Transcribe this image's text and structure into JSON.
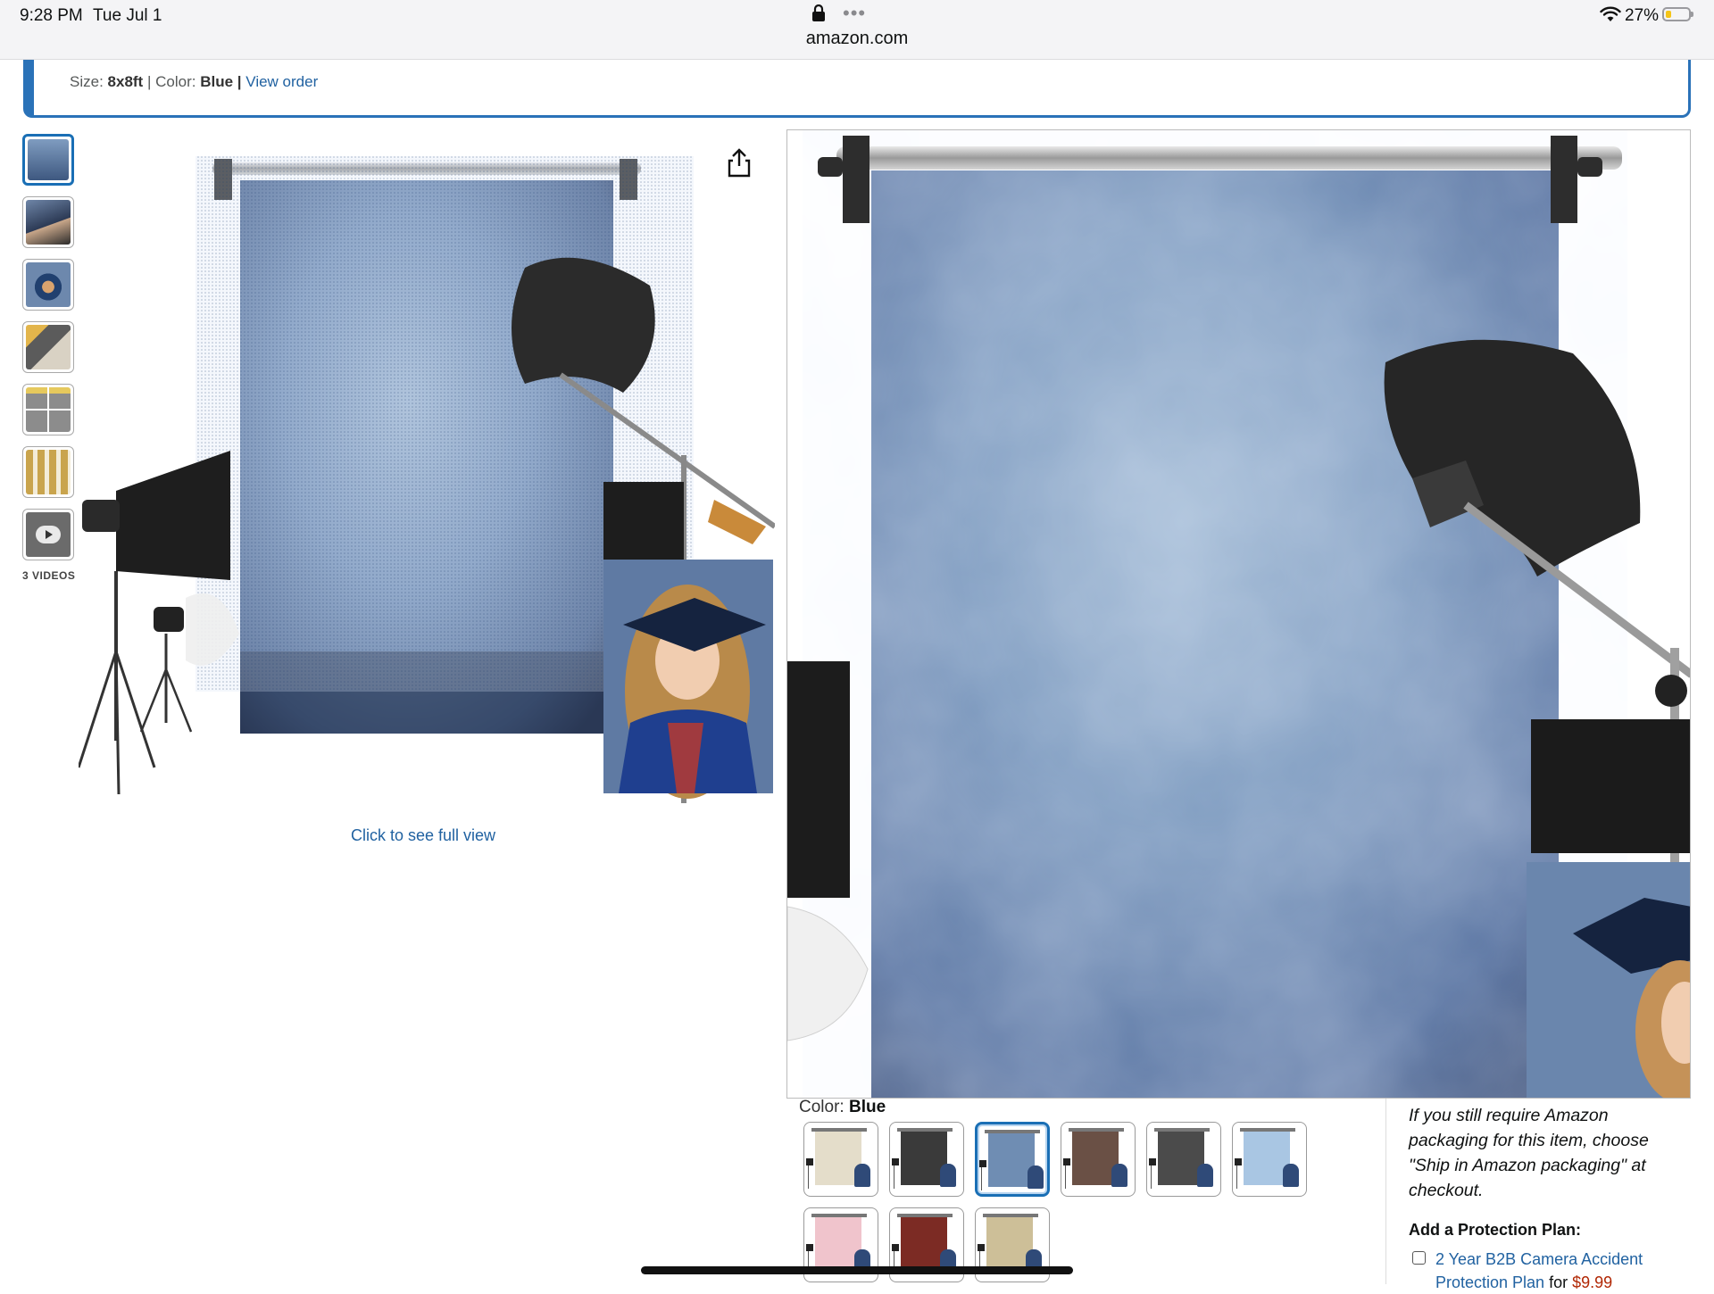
{
  "status_bar": {
    "time": "9:28 PM",
    "date": "Tue Jul 1",
    "url": "amazon.com",
    "dots": "•••",
    "battery_pct": "27%",
    "battery_level": 0.27,
    "icons": [
      "lock-icon",
      "more-dots-icon",
      "wifi-icon",
      "battery-icon"
    ]
  },
  "banner": {
    "size_label": "Size:",
    "size_value": "8x8ft",
    "color_label": "Color:",
    "color_value": "Blue",
    "separator": "|",
    "view_order": "View order"
  },
  "gallery": {
    "thumbnails": [
      {
        "name": "thumb-blue-backdrop",
        "active": true
      },
      {
        "name": "thumb-couple-portrait",
        "active": false
      },
      {
        "name": "thumb-graduate",
        "active": false
      },
      {
        "name": "thumb-fabric-detail",
        "active": false
      },
      {
        "name": "thumb-features-grid",
        "active": false
      },
      {
        "name": "thumb-size-chart",
        "active": false
      },
      {
        "name": "thumb-video",
        "active": false
      }
    ],
    "videos_label": "3 VIDEOS",
    "full_view_link": "Click to see full view",
    "share_icon": "share-icon",
    "colors": {
      "backdrop_light": "#8aa5c4",
      "backdrop_dark": "#3f5a82",
      "accent_link": "#2162a1",
      "active_border": "#1a6fb5"
    }
  },
  "variations": {
    "color_label": "Color:",
    "selected": "Blue",
    "swatches": [
      {
        "name": "swatch-cream",
        "color": "#e4ddca",
        "active": false
      },
      {
        "name": "swatch-charcoal",
        "color": "#3a3a3a",
        "active": false
      },
      {
        "name": "swatch-blue",
        "color": "#6f8db3",
        "active": true
      },
      {
        "name": "swatch-brown",
        "color": "#6a5045",
        "active": false
      },
      {
        "name": "swatch-dark-grey",
        "color": "#4b4b4b",
        "active": false
      },
      {
        "name": "swatch-light-blue",
        "color": "#a9c6e3",
        "active": false
      },
      {
        "name": "swatch-pink",
        "color": "#f0c4cc",
        "active": false
      },
      {
        "name": "swatch-red",
        "color": "#7c2b24",
        "active": false
      },
      {
        "name": "swatch-tan",
        "color": "#cdbf98",
        "active": false
      }
    ]
  },
  "buy_box": {
    "ship_note": "If you still require Amazon packaging for this item, choose \"Ship in Amazon packaging\" at checkout.",
    "protection_title": "Add a Protection Plan:",
    "protection_option": "2 Year B2B Camera Accident Protection Plan",
    "protection_for": "for",
    "protection_price": "$9.99"
  }
}
